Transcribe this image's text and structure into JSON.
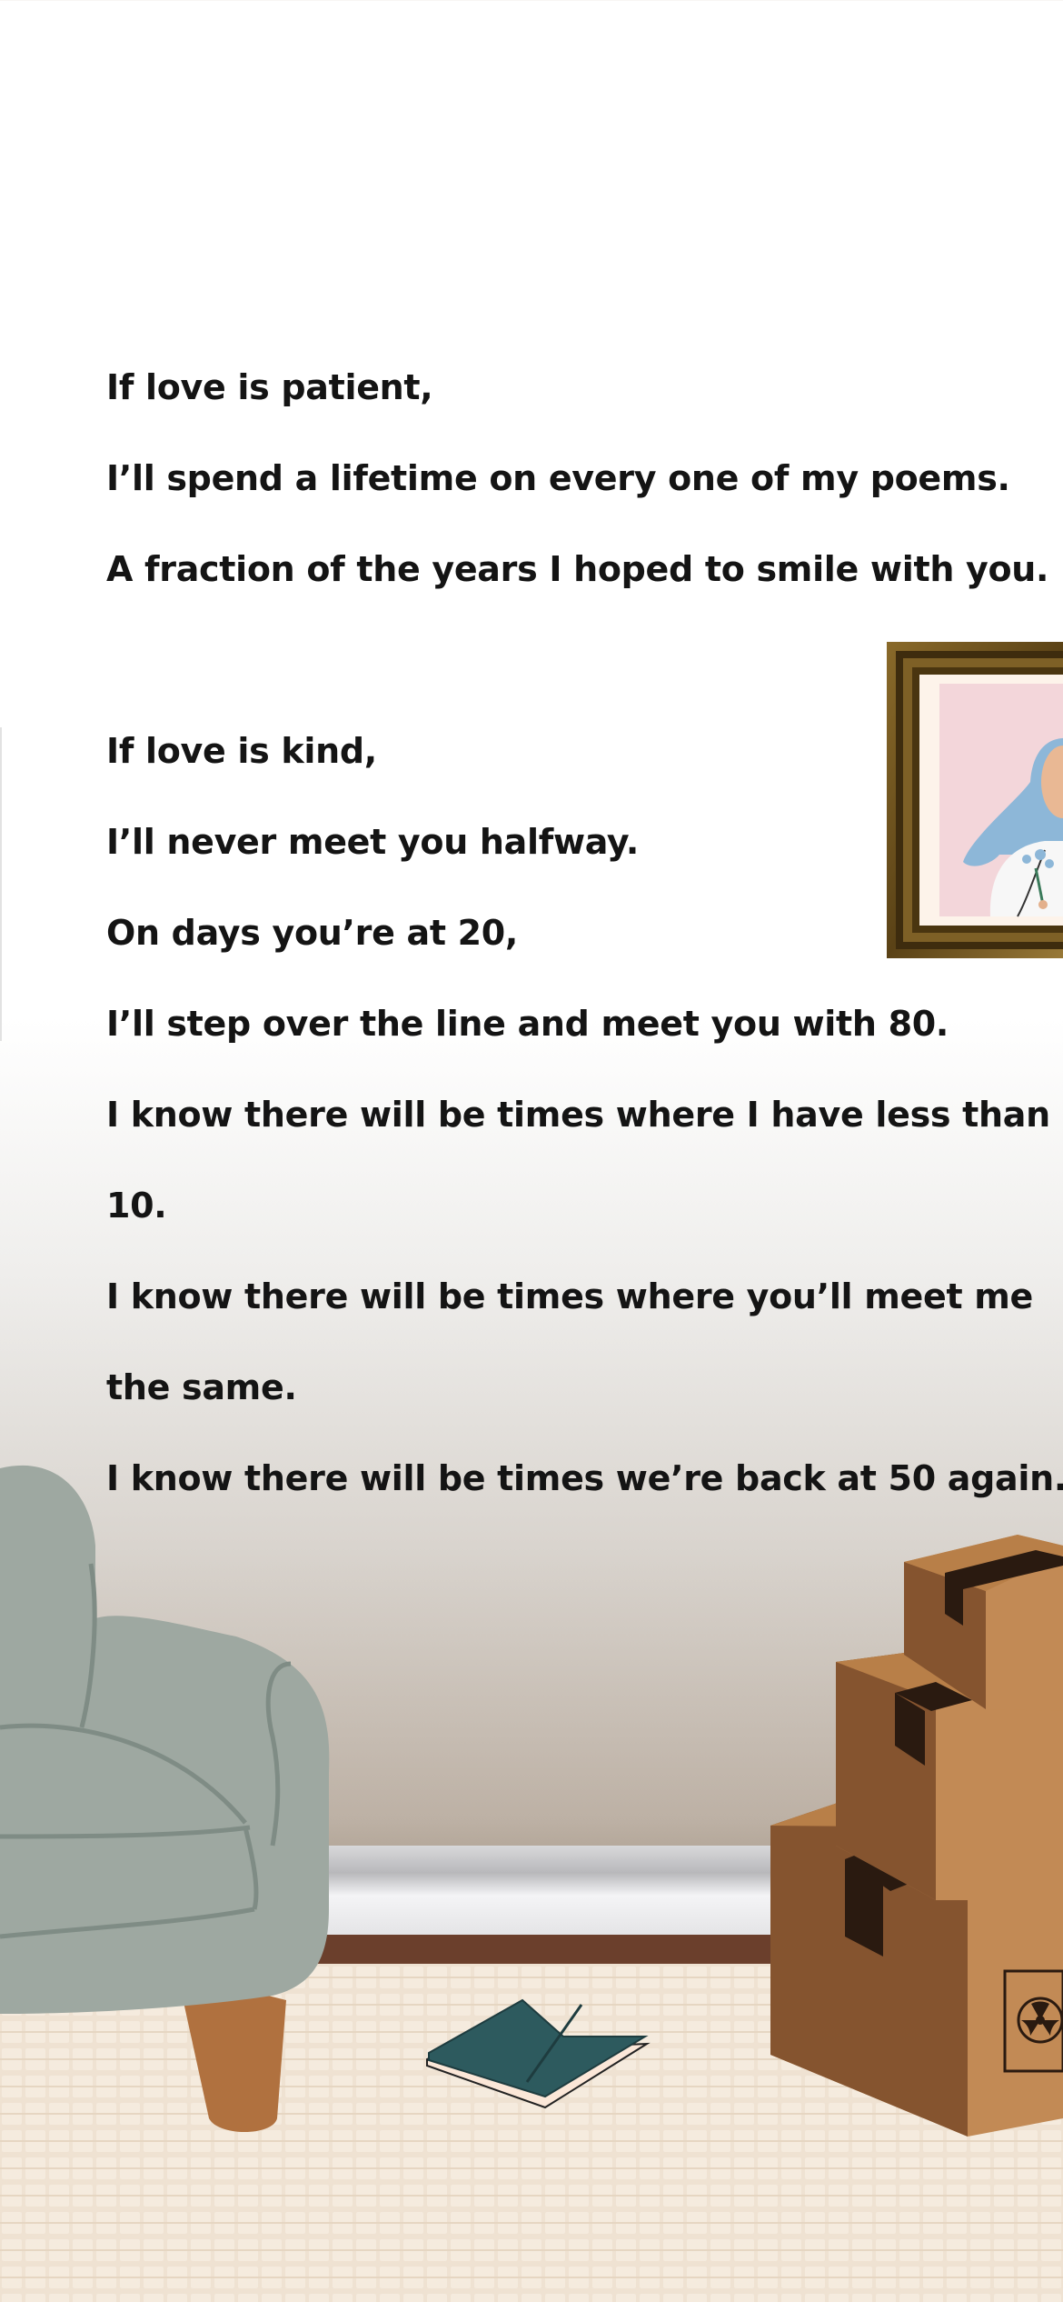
{
  "poem": {
    "stanza1": [
      "If love is patient,",
      "I’ll spend a lifetime on every one of my poems.",
      "A fraction of the years I hoped to smile with you."
    ],
    "stanza2": [
      "If love is kind,",
      "I’ll never meet you halfway.",
      "On days you’re at 20,",
      "I’ll step over the line and meet you with 80.",
      "I know there will be times where I have less than",
      "10.",
      "I know there will be times where you’ll meet me",
      "the same.",
      "I know there will be times we’re back at 50 again."
    ]
  },
  "illustration": {
    "elements": [
      "framed-portrait",
      "armchair",
      "baseboard",
      "tiled-floor",
      "open-book",
      "stacked-cardboard-boxes",
      "radiation-symbol-label"
    ],
    "colors": {
      "armchair": "#9ea8a1",
      "armchair_leg": "#b0713f",
      "box_front": "#c28a55",
      "box_side": "#85542f",
      "box_tape": "#2a1a10",
      "book_cover": "#2d5a5e",
      "frame": "#6e5420",
      "portrait_bg": "#f3d6da",
      "veil": "#8db7d8",
      "floor": "#efe2d2",
      "wall_bottom": "#b3a698"
    }
  }
}
